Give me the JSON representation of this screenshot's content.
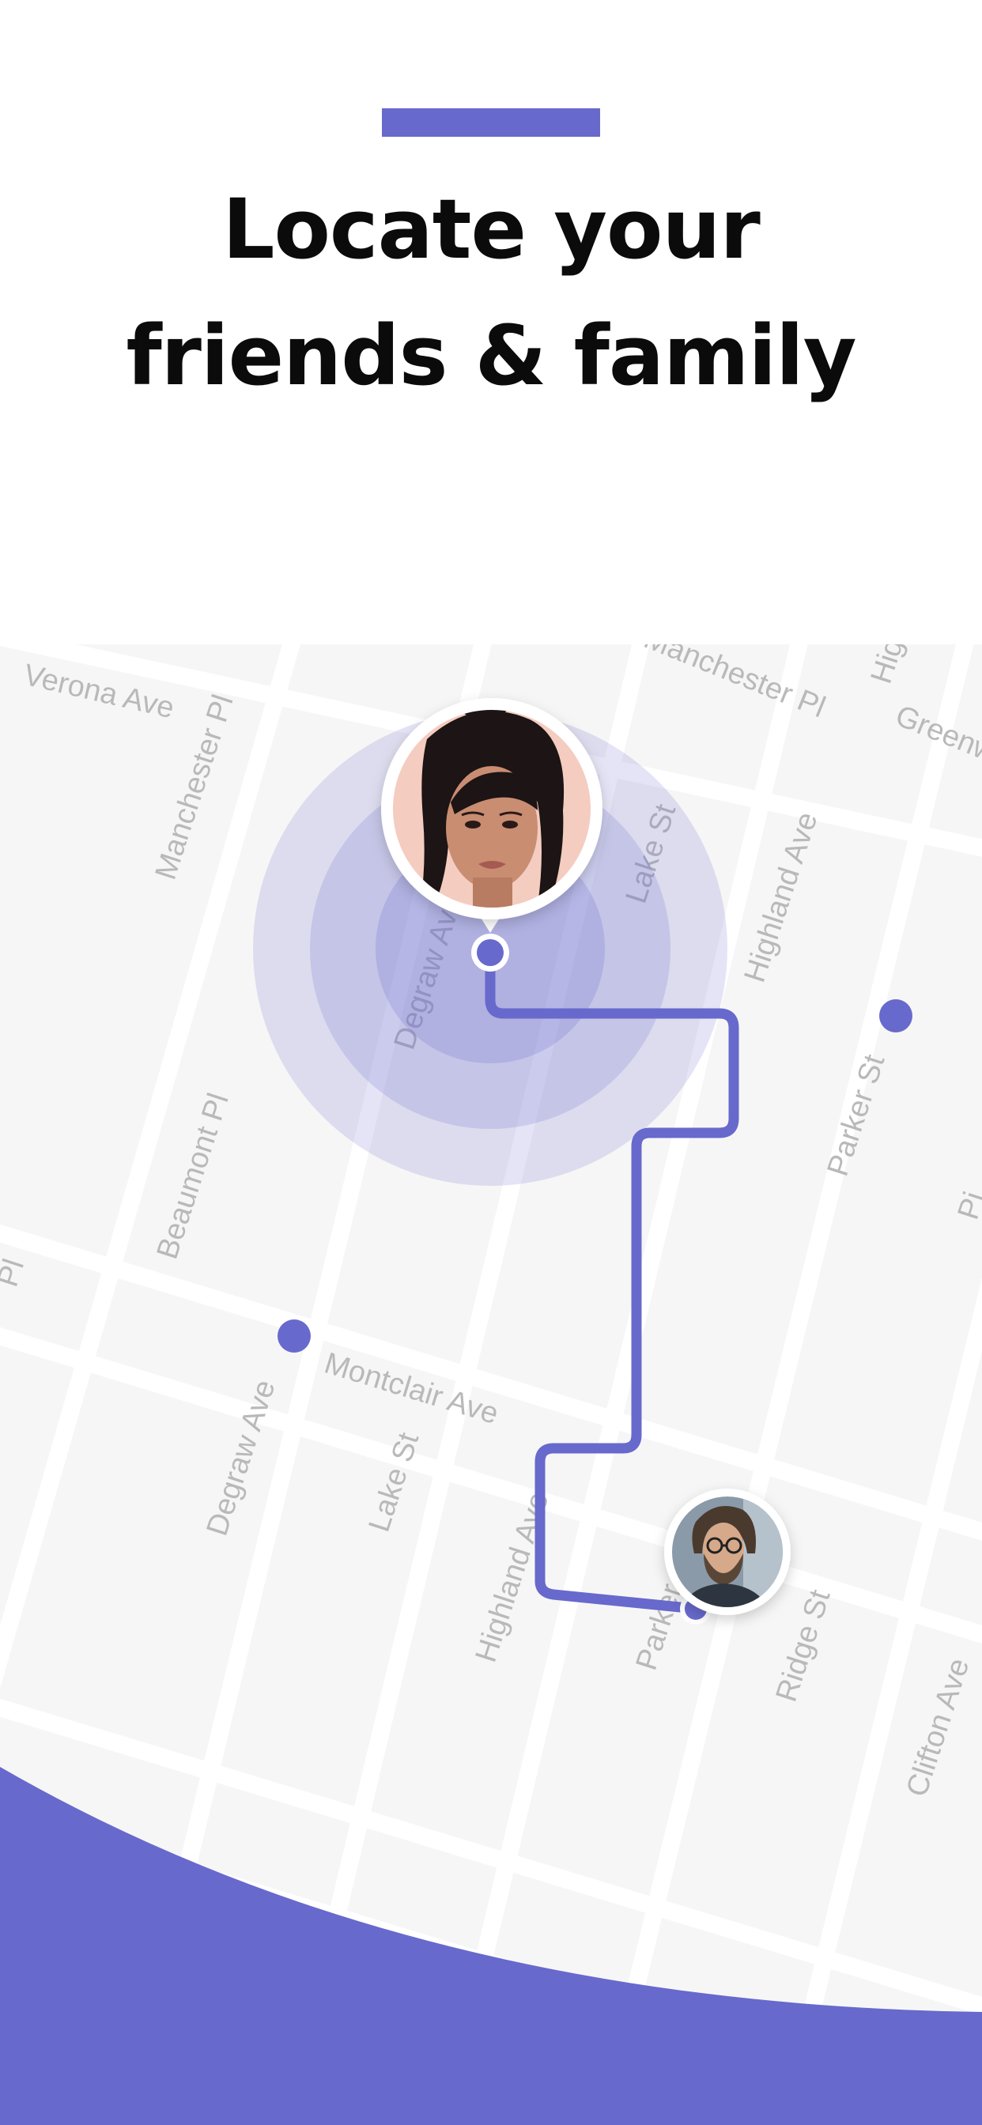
{
  "headline": {
    "line1": "Locate your",
    "line2": "friends & family"
  },
  "colors": {
    "accent": "#6869cc",
    "map_background": "#f5f5f5",
    "street": "#ffffff",
    "street_label": "#b9b9b9",
    "footer_wave": "#6869cc"
  },
  "map": {
    "street_labels": [
      "Verona Ave",
      "Manchester Pl",
      "Manchester Pl",
      "Hig",
      "Greenw",
      "Lake St",
      "Highland Ave",
      "Degraw Ave",
      "Parker St",
      "Beaumont Pl",
      "Pi",
      "Montclair Ave",
      "Degraw Ave",
      "Lake St",
      "Highland Ave",
      "Parker St",
      "Ridge St",
      "Clifton Ave",
      "Pl"
    ],
    "people": [
      {
        "name": "woman-avatar",
        "icon": "woman-portrait-icon"
      },
      {
        "name": "man-avatar",
        "icon": "man-portrait-icon"
      }
    ]
  }
}
